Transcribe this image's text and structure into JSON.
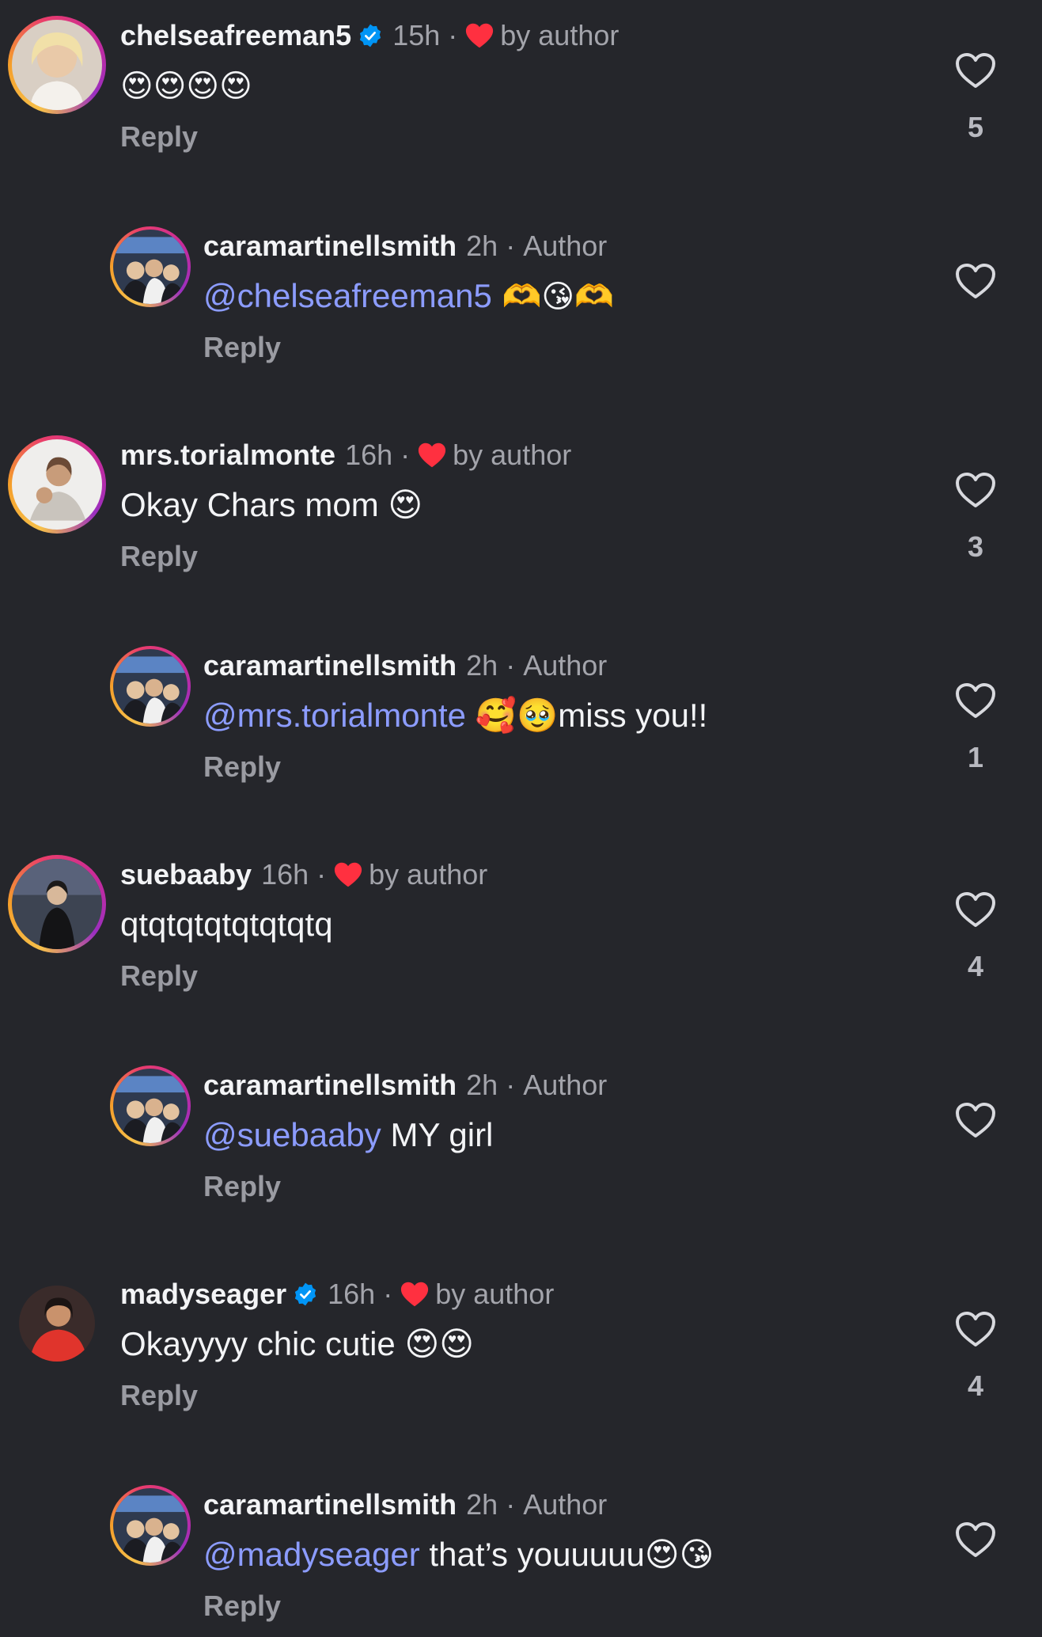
{
  "comments": [
    {
      "username": "chelseafreeman5",
      "verified": true,
      "time": "15h",
      "byline": "by author",
      "text": "😍😍😍😍",
      "mention": "",
      "reply_label": "Reply",
      "like_count": "5"
    },
    {
      "username": "caramartinellsmith",
      "time": "2h",
      "byline": "Author",
      "mention": "@chelseafreeman5",
      "text": " 🫶😘🫶",
      "reply_label": "Reply",
      "like_count": ""
    },
    {
      "username": "mrs.torialmonte",
      "time": "16h",
      "byline": "by author",
      "mention": "",
      "text": "Okay Chars mom 😍",
      "reply_label": "Reply",
      "like_count": "3"
    },
    {
      "username": "caramartinellsmith",
      "time": "2h",
      "byline": "Author",
      "mention": "@mrs.torialmonte",
      "text": " 🥰🥹miss you!!",
      "reply_label": "Reply",
      "like_count": "1"
    },
    {
      "username": "suebaaby",
      "time": "16h",
      "byline": "by author",
      "mention": "",
      "text": "qtqtqtqtqtqtqtq",
      "reply_label": "Reply",
      "like_count": "4"
    },
    {
      "username": "caramartinellsmith",
      "time": "2h",
      "byline": "Author",
      "mention": "@suebaaby",
      "text": " MY girl",
      "reply_label": "Reply",
      "like_count": ""
    },
    {
      "username": "madyseager",
      "verified": true,
      "time": "16h",
      "byline": "by author",
      "mention": "",
      "text": "Okayyyy chic cutie 😍😍",
      "reply_label": "Reply",
      "like_count": "4"
    },
    {
      "username": "caramartinellsmith",
      "time": "2h",
      "byline": "Author",
      "mention": "@madyseager",
      "text": " that’s youuuuu😍😘",
      "reply_label": "Reply",
      "like_count": ""
    }
  ],
  "colors": {
    "background": "#25262b",
    "mention": "#8c9cff",
    "author_heart": "#ff3040",
    "verified": "#0095f6"
  }
}
